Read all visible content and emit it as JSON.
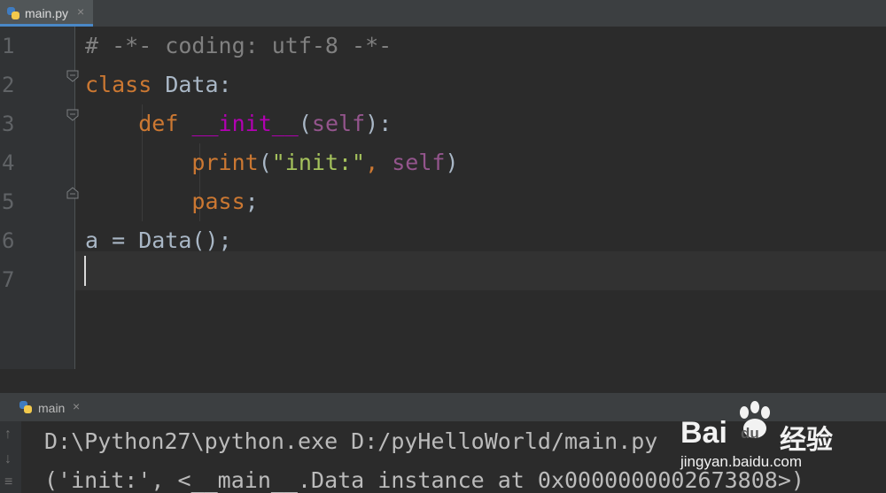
{
  "tab": {
    "label": "main.py",
    "close": "×",
    "icon": "python-file-icon"
  },
  "editor": {
    "lines": [
      {
        "num": "1",
        "parts": [
          {
            "t": "# -*- coding: utf-8 -*-",
            "c": "cmt"
          }
        ]
      },
      {
        "num": "2",
        "parts": [
          {
            "t": "class",
            "c": "kw"
          },
          {
            "t": " Data:",
            "c": ""
          }
        ]
      },
      {
        "num": "3",
        "parts": [
          {
            "t": "    ",
            "c": ""
          },
          {
            "t": "def",
            "c": "kw"
          },
          {
            "t": " ",
            "c": ""
          },
          {
            "t": "__init__",
            "c": "magic"
          },
          {
            "t": "(",
            "c": ""
          },
          {
            "t": "self",
            "c": "slf"
          },
          {
            "t": "):",
            "c": ""
          }
        ]
      },
      {
        "num": "4",
        "parts": [
          {
            "t": "        ",
            "c": ""
          },
          {
            "t": "print",
            "c": "kw"
          },
          {
            "t": "(",
            "c": ""
          },
          {
            "t": "\"init:\"",
            "c": "str"
          },
          {
            "t": ", ",
            "c": "kw"
          },
          {
            "t": "self",
            "c": "slf"
          },
          {
            "t": ")",
            "c": ""
          }
        ]
      },
      {
        "num": "5",
        "parts": [
          {
            "t": "        ",
            "c": ""
          },
          {
            "t": "pass",
            "c": "kw"
          },
          {
            "t": ";",
            "c": ""
          }
        ]
      },
      {
        "num": "6",
        "parts": [
          {
            "t": "a = Data();",
            "c": ""
          }
        ]
      },
      {
        "num": "7",
        "parts": []
      }
    ]
  },
  "run": {
    "tab_label": "main",
    "close": "×",
    "icon": "python-run-icon"
  },
  "console": {
    "lines": [
      "D:\\Python27\\python.exe D:/pyHelloWorld/main.py",
      "('init:', <__main__.Data instance at 0x0000000002673808>)"
    ],
    "side_icons": [
      "up-arrow-icon",
      "down-arrow-icon",
      "wrap-icon"
    ]
  },
  "watermark": {
    "brand": "Bai",
    "brand2": "du",
    "cn": "经验",
    "url": "jingyan.baidu.com"
  }
}
